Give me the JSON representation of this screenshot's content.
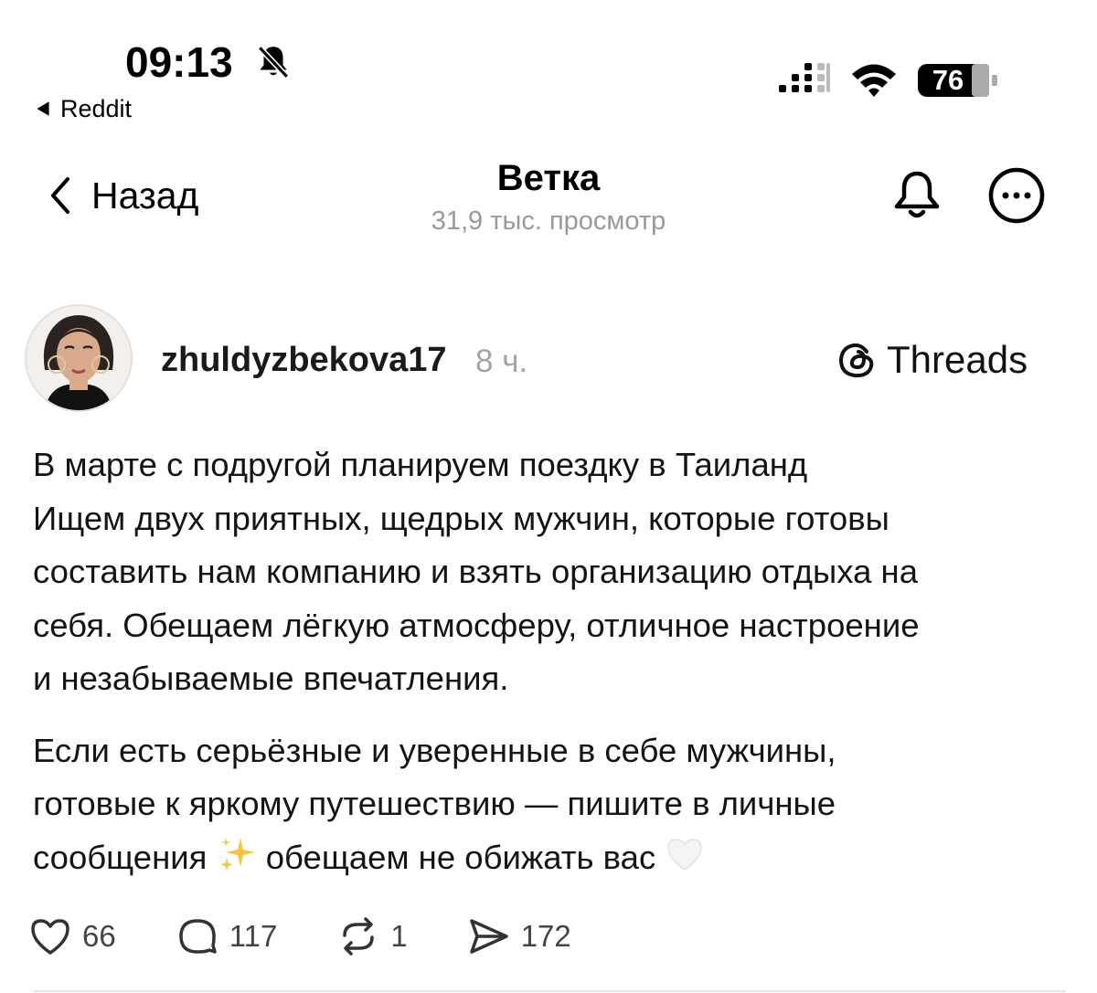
{
  "status_bar": {
    "time": "09:13",
    "back_app": "Reddit",
    "battery": "76"
  },
  "nav": {
    "back_label": "Назад",
    "title": "Ветка",
    "subtitle": "31,9 тыс. просмотр"
  },
  "post": {
    "username": "zhuldyzbekova17",
    "time": "8 ч.",
    "source": "Threads",
    "paragraph1_lines": [
      "В марте с подругой планируем поездку в Таиланд",
      "Ищем двух приятных, щедрых мужчин, которые готовы",
      "составить нам компанию и взять организацию отдыха на",
      "себя. Обещаем лёгкую атмосферу, отличное настроение",
      "и незабываемые впечатления."
    ],
    "paragraph2_lines": [
      "Если есть серьёзные и уверенные в себе мужчины,",
      "готовые к яркому путешествию — пишите в личные"
    ],
    "paragraph2_last_a": "сообщения",
    "paragraph2_last_b": "обещаем не обижать вас",
    "emoji_1": "sparkles-icon",
    "emoji_2": "white-heart-icon"
  },
  "actions": {
    "likes": "66",
    "comments": "117",
    "reposts": "1",
    "shares": "172"
  },
  "colors": {
    "text": "#141414",
    "muted": "#9a9a9a",
    "background": "#ffffff"
  }
}
